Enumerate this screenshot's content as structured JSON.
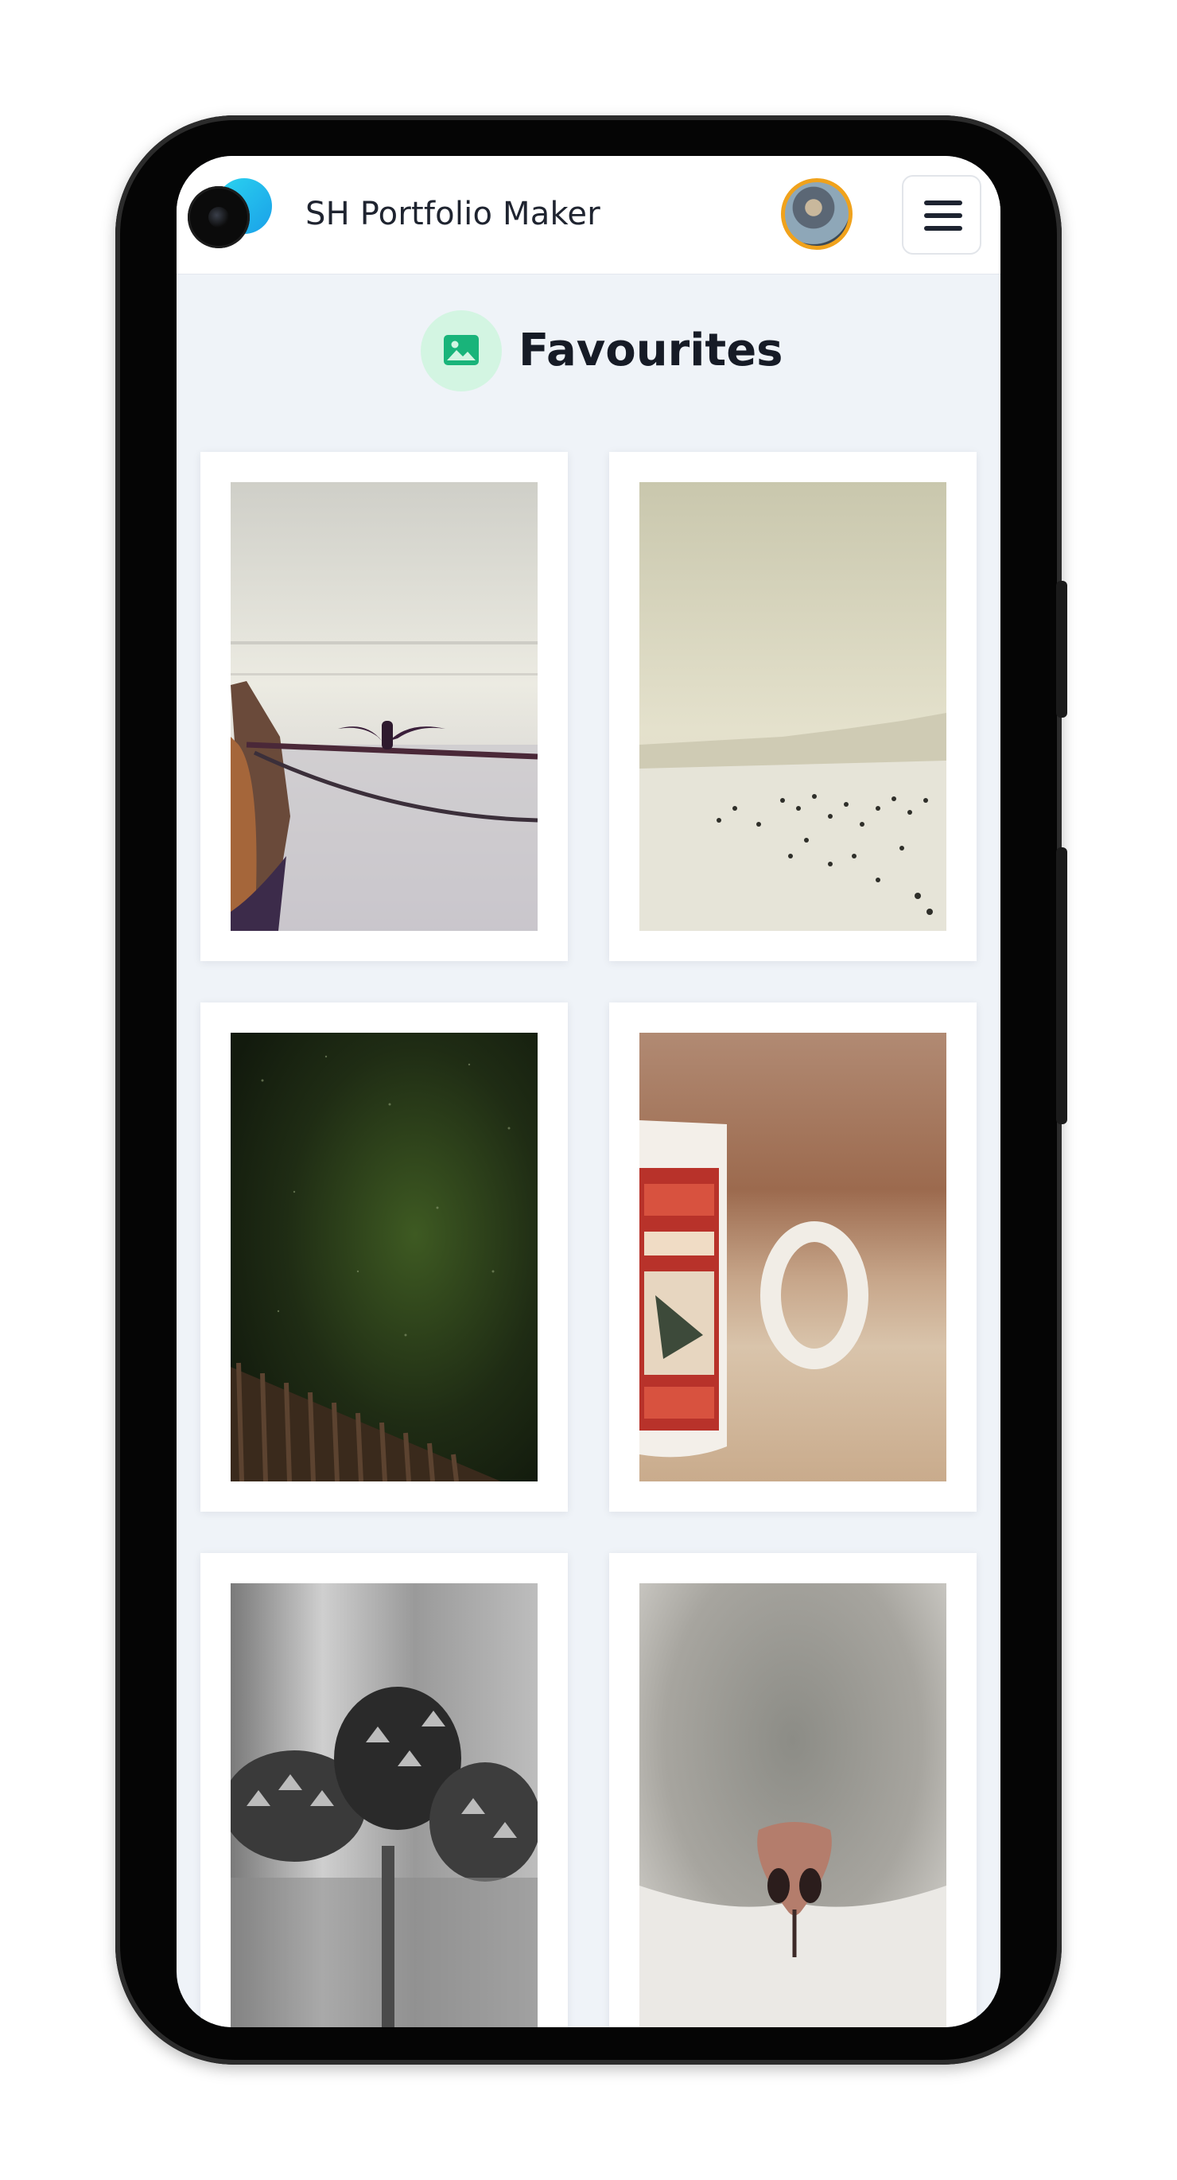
{
  "header": {
    "app_title": "SH Portfolio Maker",
    "avatar_alt": "User avatar",
    "menu_icon": "hamburger-menu-icon",
    "accent_color": "#f0a21c"
  },
  "section": {
    "title": "Favourites",
    "icon": "image-icon",
    "icon_bg_color": "#d3f5e2",
    "icon_color": "#19b47a"
  },
  "gallery": {
    "items": [
      {
        "subject": "bird-on-rope-by-sea-photo"
      },
      {
        "subject": "beach-crowd-photo"
      },
      {
        "subject": "night-sky-over-fence-photo"
      },
      {
        "subject": "coffee-mug-photo"
      },
      {
        "subject": "pine-cones-photo"
      },
      {
        "subject": "cat-nose-photo"
      }
    ]
  }
}
